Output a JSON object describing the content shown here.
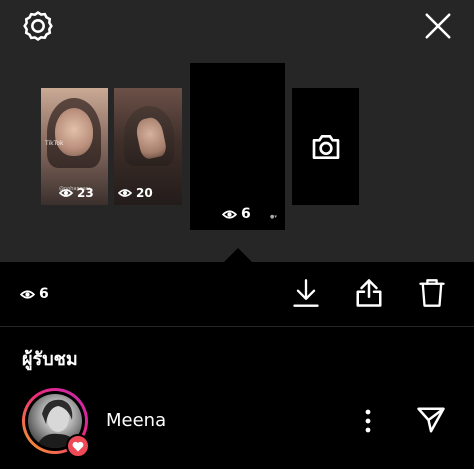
{
  "header": {
    "settings_icon": "gear-icon",
    "close_icon": "close-icon"
  },
  "thumbnails": [
    {
      "views": "23",
      "overlay_text": "TikTok",
      "username": "@nohapoaw"
    },
    {
      "views": "20"
    },
    {
      "views": "6",
      "selected": true
    },
    {
      "type": "camera",
      "icon": "camera-icon"
    }
  ],
  "toolbar": {
    "views": "6",
    "actions": [
      "download-icon",
      "share-icon",
      "trash-icon"
    ]
  },
  "viewers": {
    "heading": "ผู้รับชม",
    "items": [
      {
        "name": "Meena",
        "liked": true
      }
    ]
  },
  "colors": {
    "top_panel": "#262626",
    "background": "#000000",
    "heart": "#ed4956",
    "story_ring": [
      "#f5a623",
      "#ee2a7b",
      "#c028b9"
    ]
  }
}
